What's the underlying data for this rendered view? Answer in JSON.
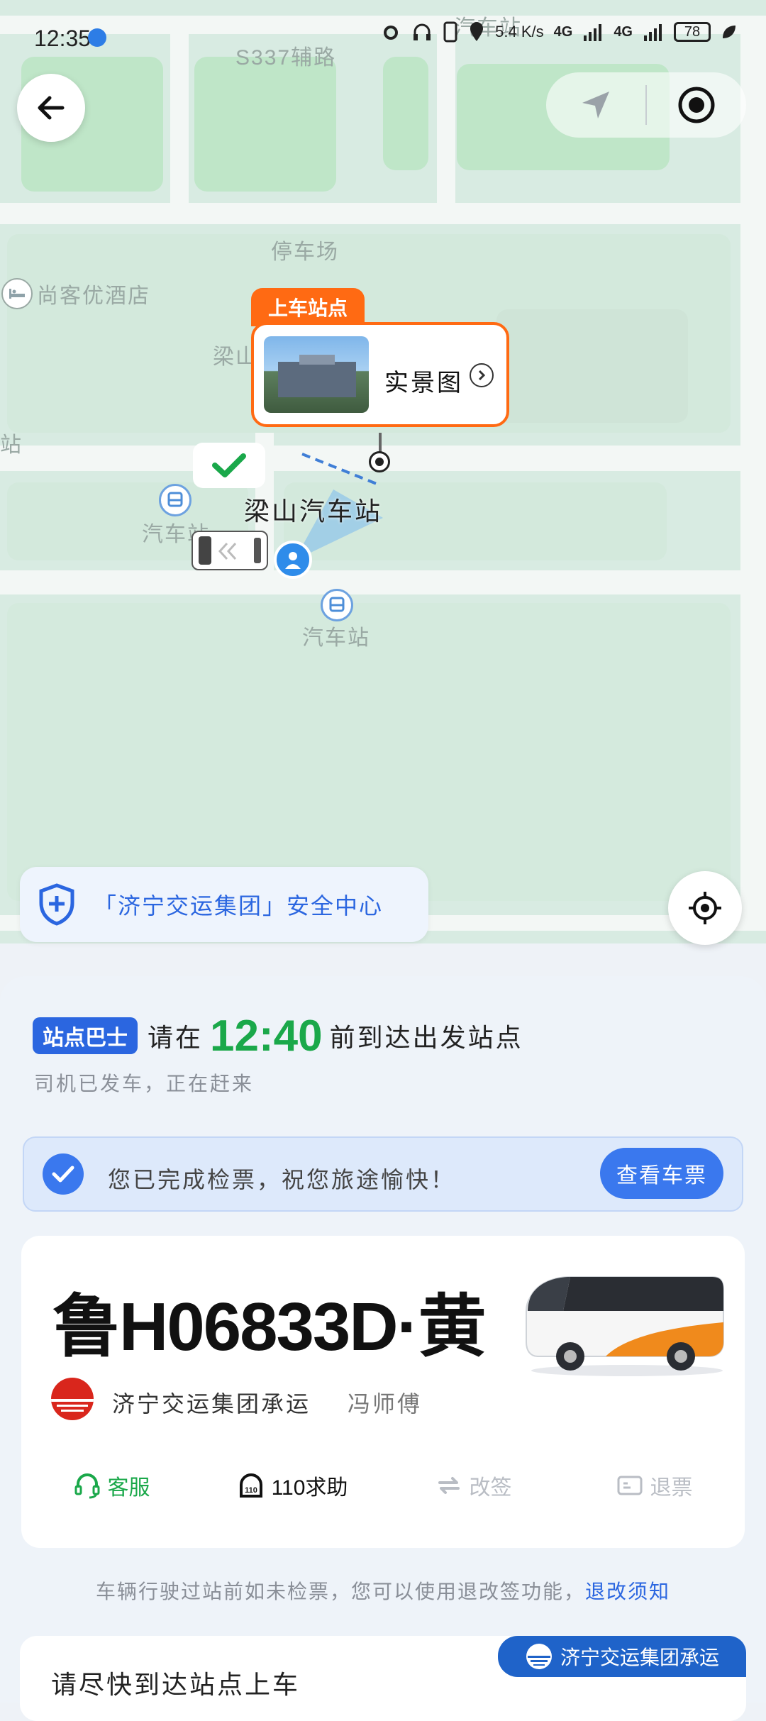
{
  "status_bar": {
    "time": "12:35",
    "net_speed": "5.4 K/s",
    "signal1": "4G",
    "signal2": "4G",
    "battery": "78"
  },
  "map": {
    "road_label": "S337辅路",
    "parking_label": "停车场",
    "hotel_label": "尚客优酒店",
    "top_label": "汽车站",
    "left_label": "站",
    "station_name": "梁山汽车站",
    "bus_stop_label_1": "汽车站",
    "bus_stop_label_2": "汽车站",
    "partial_label": "梁山"
  },
  "popup": {
    "tag": "上车站点",
    "label": "实景图"
  },
  "safety_center": {
    "label": "「济宁交运集团」安全中心"
  },
  "header": {
    "badge": "站点巴士",
    "prefix": "请在",
    "time": "12:40",
    "suffix": "前到达出发站点",
    "subline": "司机已发车，正在赶来"
  },
  "check_banner": {
    "text": "您已完成检票，祝您旅途愉快！",
    "button": "查看车票"
  },
  "vehicle": {
    "plate": "鲁H06833D·黄",
    "company": "济宁交运集团承运",
    "driver": "冯师傅"
  },
  "actions": [
    {
      "label": "客服",
      "color": "#1aa84a"
    },
    {
      "label": "110求助",
      "color": "#111111"
    },
    {
      "label": "改签",
      "color": "#b9bdc4"
    },
    {
      "label": "退票",
      "color": "#b9bdc4"
    }
  ],
  "notice": {
    "text": "车辆行驶过站前如未检票，您可以使用退改签功能，",
    "link": "退改须知"
  },
  "bottom": {
    "tag": "济宁交运集团承运",
    "title": "请尽快到达站点上车"
  },
  "colors": {
    "accent": "#2b66e0",
    "orange": "#ff6a13",
    "green": "#1aa84a"
  }
}
